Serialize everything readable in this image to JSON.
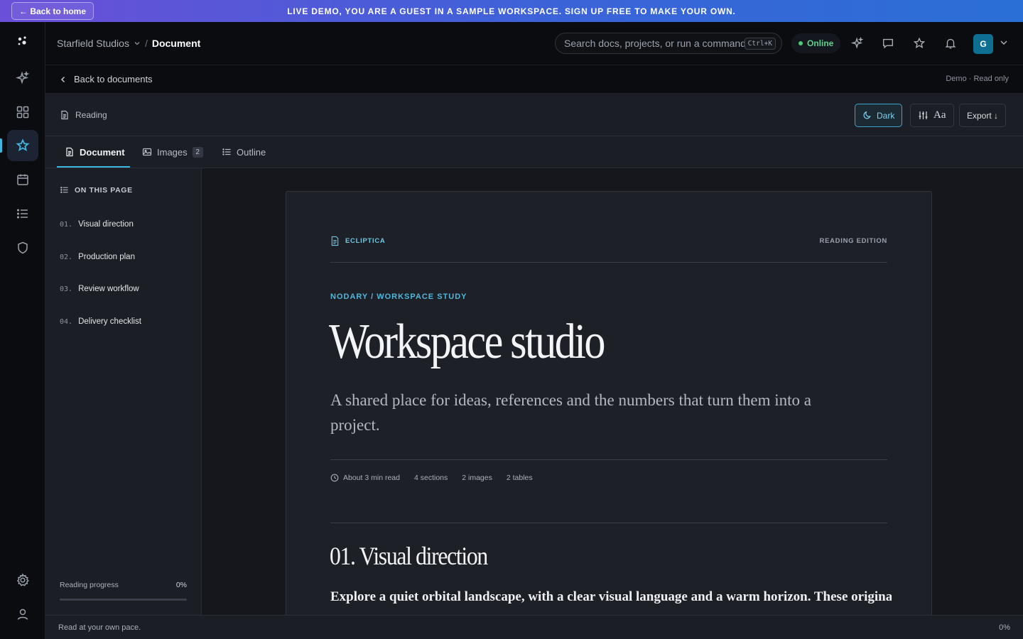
{
  "banner": {
    "back_label": "← Back to home",
    "text": "LIVE DEMO, YOU ARE A GUEST IN A SAMPLE WORKSPACE. SIGN UP FREE TO MAKE YOUR OWN."
  },
  "header": {
    "workspace": "Starfield Studios",
    "separator": "/",
    "page": "Document",
    "search_placeholder": "Search docs, projects, or run a command",
    "search_shortcut": "Ctrl+K",
    "status": "Online",
    "avatar_initial": "G"
  },
  "subbar": {
    "back_label": "Back to documents",
    "mode_note": "Demo · Read only"
  },
  "toolbar": {
    "mode_label": "Reading",
    "theme_label": "Dark",
    "typography_label": "Aa",
    "export_label": "Export ↓"
  },
  "tabs": [
    {
      "label": "Document"
    },
    {
      "label": "Images",
      "count": "2"
    },
    {
      "label": "Outline"
    }
  ],
  "outline": {
    "heading": "ON THIS PAGE",
    "items": [
      {
        "num": "01.",
        "label": "Visual direction"
      },
      {
        "num": "02.",
        "label": "Production plan"
      },
      {
        "num": "03.",
        "label": "Review workflow"
      },
      {
        "num": "04.",
        "label": "Delivery checklist"
      }
    ],
    "progress_label": "Reading progress",
    "progress_value": "0%",
    "progress_fraction": 0
  },
  "document": {
    "brand": "ECLIPTICA",
    "edition": "READING EDITION",
    "kicker": "NODARY / WORKSPACE STUDY",
    "title": "Workspace studio",
    "lede": "A shared place for ideas, references and the numbers that turn them into a project.",
    "meta": {
      "read_time": "About 3 min read",
      "sections": "4 sections",
      "images": "2 images",
      "tables": "2 tables"
    },
    "section_heading": "01. Visual direction",
    "section_text": "Explore a quiet orbital landscape, with a clear visual language and a warm horizon. These original"
  },
  "footer": {
    "left": "Read at your own pace.",
    "right": "0%"
  },
  "colors": {
    "accent": "#3fb6e0",
    "online": "#4cc97c",
    "banner_start": "#6b4fd8",
    "banner_end": "#2a6fd6"
  }
}
